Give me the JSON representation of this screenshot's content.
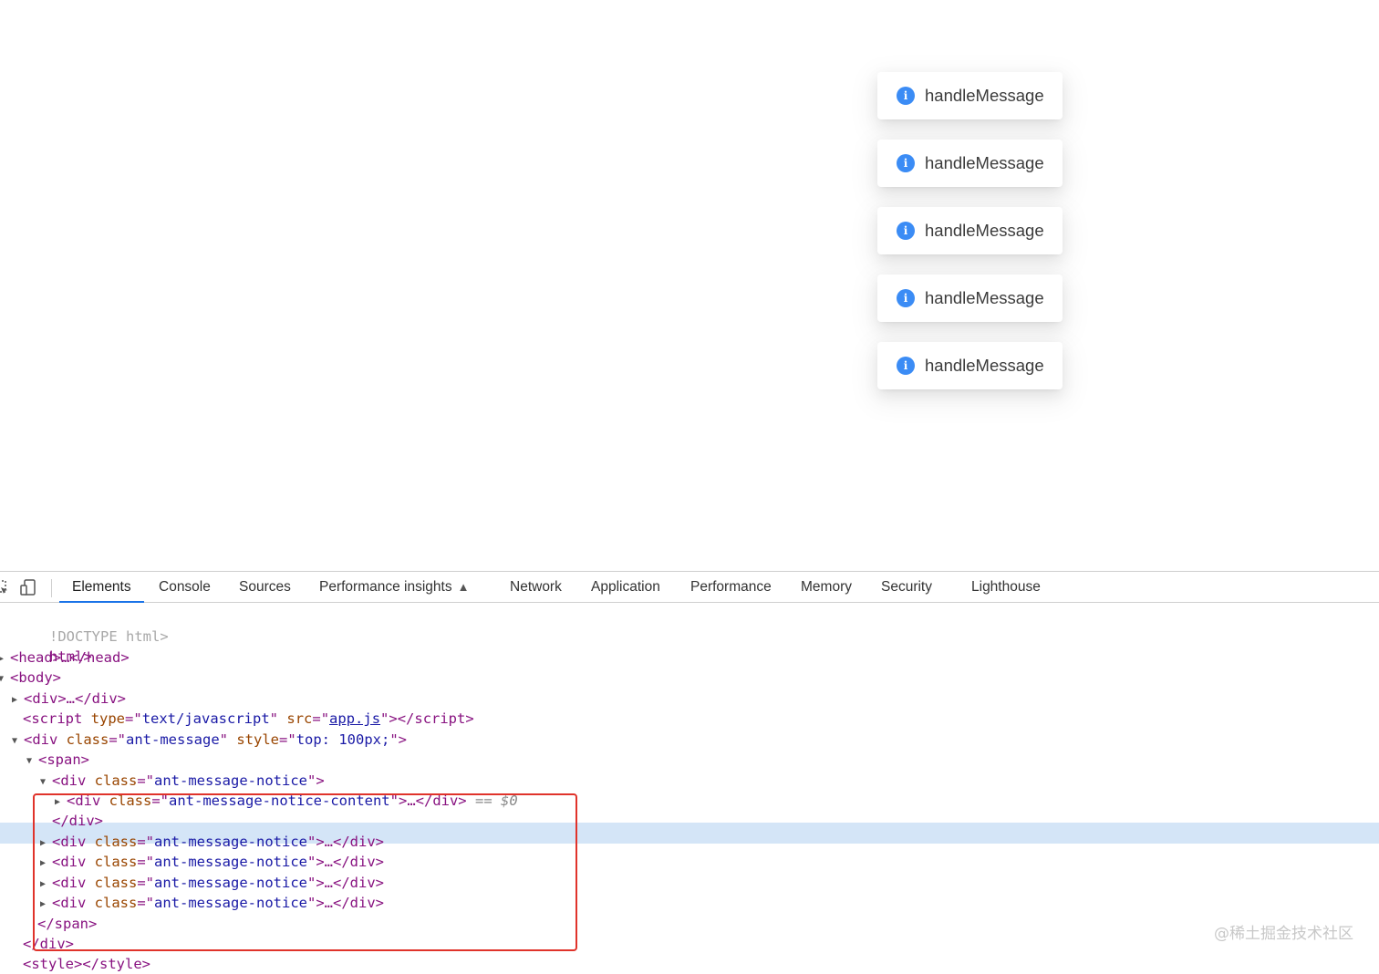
{
  "messages": [
    {
      "icon": "info-circle-icon",
      "text": "handleMessage"
    },
    {
      "icon": "info-circle-icon",
      "text": "handleMessage"
    },
    {
      "icon": "info-circle-icon",
      "text": "handleMessage"
    },
    {
      "icon": "info-circle-icon",
      "text": "handleMessage"
    },
    {
      "icon": "info-circle-icon",
      "text": "handleMessage"
    }
  ],
  "devtools": {
    "tabs": [
      "Elements",
      "Console",
      "Sources",
      "Performance insights",
      "Network",
      "Application",
      "Performance",
      "Memory",
      "Security",
      "Lighthouse"
    ],
    "active_tab": "Elements",
    "accent_color": "#1a73e8",
    "dom_tree": {
      "doctype": "!DOCTYPE html>",
      "html_open": "html>",
      "head": "<head>…</head>",
      "body_open": "<body>",
      "div_collapsed": "<div>…</div>",
      "script": {
        "tag": "script",
        "type_attr": "type",
        "type_val": "text/javascript",
        "src_attr": "src",
        "src_val": "app.js"
      },
      "ant_message": {
        "class_val": "ant-message",
        "style_val": "top: 100px;"
      },
      "span_open": "<span>",
      "notice_class": "ant-message-notice",
      "notice_content_class": "ant-message-notice-content",
      "selected_marker": "== $0",
      "div_close": "</div>",
      "span_close": "</span>",
      "outer_div_close": "</div>",
      "style": "<style></style>"
    }
  },
  "watermark": "@稀土掘金技术社区"
}
